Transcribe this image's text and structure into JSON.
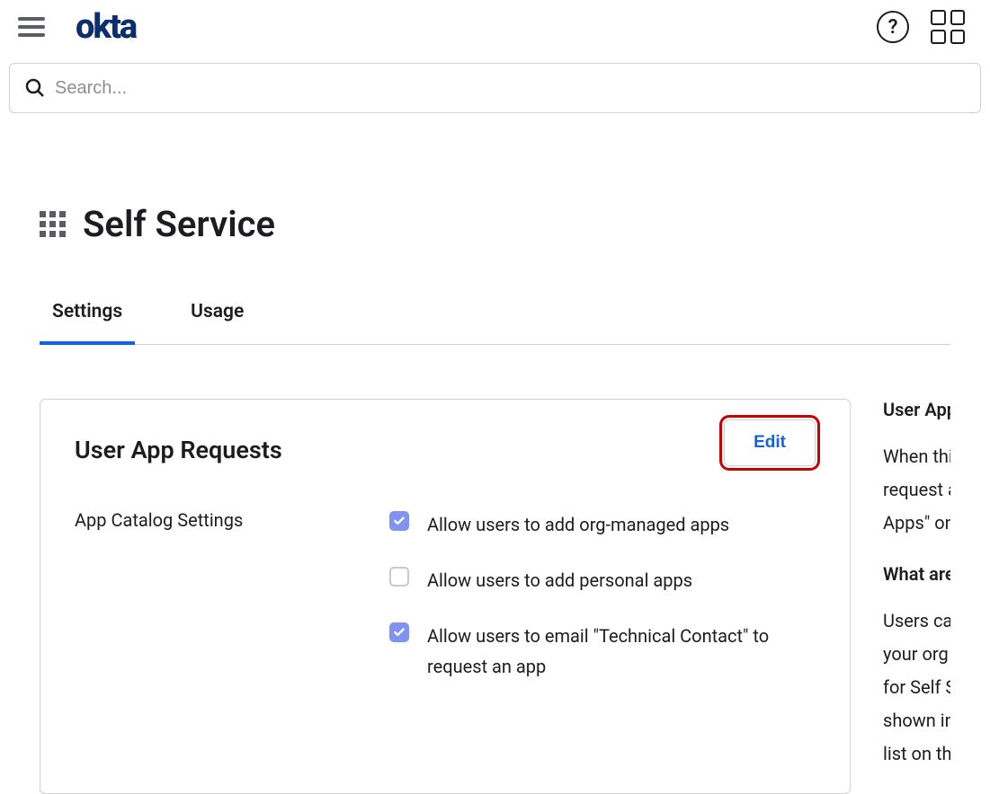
{
  "header": {
    "logo_text": "okta"
  },
  "search": {
    "placeholder": "Search..."
  },
  "page": {
    "title": "Self Service"
  },
  "tabs": [
    {
      "label": "Settings",
      "active": true
    },
    {
      "label": "Usage",
      "active": false
    }
  ],
  "card": {
    "title": "User App Requests",
    "edit_label": "Edit",
    "section_label": "App Catalog Settings",
    "checkboxes": [
      {
        "label": "Allow users to add org-managed apps",
        "checked": true
      },
      {
        "label": "Allow users to add personal apps",
        "checked": false
      },
      {
        "label": "Allow users to email \"Technical Contact\" to request an app",
        "checked": true
      }
    ]
  },
  "sidebar": {
    "heading1": "User App Re",
    "text1": "When this is\nrequest apps\nApps\" on the",
    "heading2": "What are or",
    "text2": "Users can re\nyour org has\nfor Self Serv\nshown in the\nlist on the le"
  }
}
